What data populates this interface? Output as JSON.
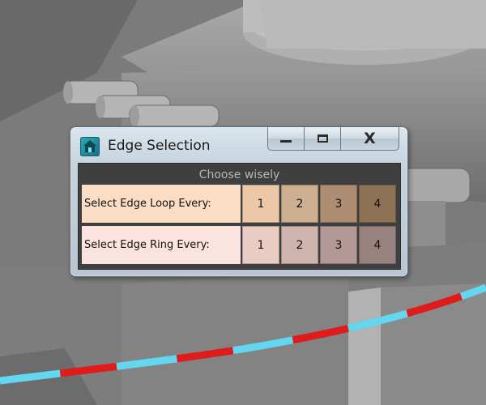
{
  "window": {
    "title": "Edge Selection",
    "close_glyph": "X"
  },
  "dialog": {
    "header": "Choose wisely",
    "rows": [
      {
        "label": "Select Edge Loop Every:",
        "buttons": [
          {
            "label": "1",
            "color": "#ecc8a8"
          },
          {
            "label": "2",
            "color": "#ccae91"
          },
          {
            "label": "3",
            "color": "#ad8e72"
          },
          {
            "label": "4",
            "color": "#8f7356"
          }
        ]
      },
      {
        "label": "Select Edge Ring Every:",
        "buttons": [
          {
            "label": "1",
            "color": "#e9cdc5"
          },
          {
            "label": "2",
            "color": "#cfb4ae"
          },
          {
            "label": "3",
            "color": "#b29896"
          },
          {
            "label": "4",
            "color": "#988280"
          }
        ]
      }
    ]
  },
  "icons": {
    "app": "maya-house-icon",
    "minimize": "minimize-icon",
    "maximize": "maximize-icon",
    "close": "close-icon"
  },
  "colors": {
    "edge_highlight_cyan": "#63d6f0",
    "edge_highlight_red": "#e01b1b",
    "viewport_gray": "#7a7a7a"
  }
}
